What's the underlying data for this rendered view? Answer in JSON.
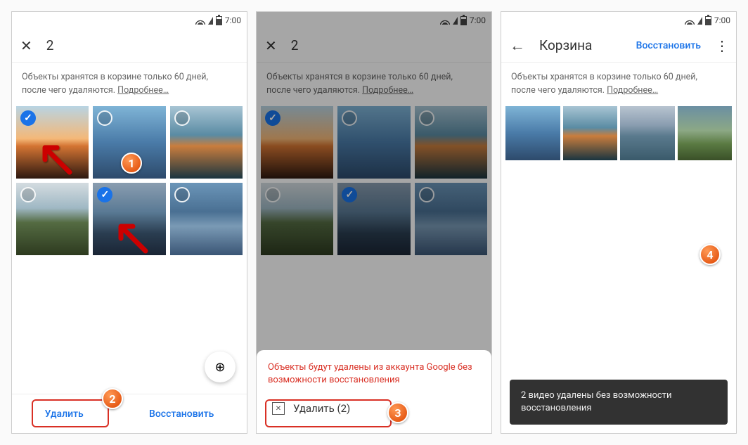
{
  "status": {
    "time": "7:00"
  },
  "phone1": {
    "toolbar": {
      "count": "2"
    },
    "notice_line1": "Объекты хранятся в корзине только 60 дней,",
    "notice_line2": "после чего удаляются. ",
    "notice_link": "Подробнее…",
    "delete": "Удалить",
    "restore": "Восстановить",
    "magnify": "⊕"
  },
  "phone2": {
    "toolbar": {
      "count": "2"
    },
    "notice_line1": "Объекты хранятся в корзине только 60 дней,",
    "notice_line2": "после чего удаляются. ",
    "notice_link": "Подробнее…",
    "warn": "Объекты будут удалены из аккаунта Google без возможности восстановления",
    "sheet_delete": "Удалить (2)"
  },
  "phone3": {
    "toolbar": {
      "title": "Корзина",
      "restore": "Восстановить"
    },
    "notice_line1": "Объекты хранятся в корзине только 60 дней,",
    "notice_line2": "после чего удаляются. ",
    "notice_link": "Подробнее…",
    "snackbar": "2 видео удалены без возможности восстановления"
  },
  "badges": {
    "b1": "1",
    "b2": "2",
    "b3": "3",
    "b4": "4"
  }
}
